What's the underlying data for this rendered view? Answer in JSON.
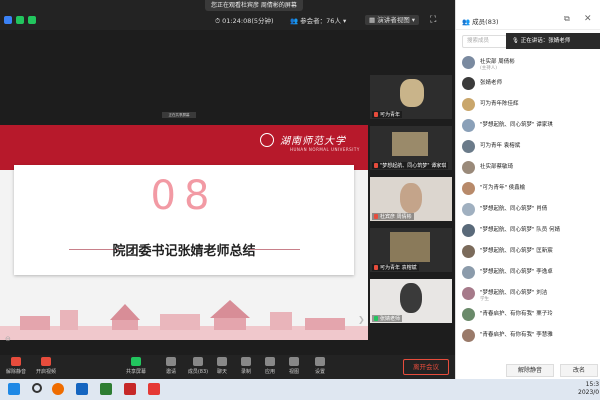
{
  "window": {
    "notice": "您正在观看杜宾彦 周倩彬的屏幕",
    "time": "01:24:08(5分钟)",
    "participants": "参会者：76人",
    "view_mode": "演讲者视图"
  },
  "slide": {
    "caption": "正在共享屏幕",
    "university_cn": "湖南师范大学",
    "university_en": "HUNAN NORMAL UNIVERSITY",
    "number": "08",
    "title": "院团委书记张婧老师总结"
  },
  "videos": [
    {
      "label": "可为青年"
    },
    {
      "label": "\"梦想起航、同心筑梦\" 谭家琪"
    },
    {
      "label": "杜宾彦 周倩彬"
    },
    {
      "label": "可为青年 袁榕斌"
    },
    {
      "label": "张婧老师"
    }
  ],
  "toolbar": {
    "buttons": [
      "解除静音",
      "开启视频",
      "共享屏幕",
      "邀请",
      "成员(83)",
      "聊天",
      "录制",
      "应用",
      "视图",
      "设置"
    ],
    "end_meeting": "离开会议"
  },
  "panel": {
    "title": "成员(83)",
    "search_placeholder": "搜索成员",
    "speaking": "正在讲话：张婧老师",
    "members": [
      {
        "name": "社实部 周倩彬",
        "sub": "(主持人)",
        "color": "#7a8aa0"
      },
      {
        "name": "张婧老师",
        "sub": "",
        "color": "#3b3b3b"
      },
      {
        "name": "可为青年陈佳辉",
        "sub": "",
        "color": "#c9a66b"
      },
      {
        "name": "\"梦想起航、同心筑梦\" 谭家琪",
        "sub": "",
        "color": "#8aa0b8"
      },
      {
        "name": "可为青年 袁榕斌",
        "sub": "",
        "color": "#6b7b8a"
      },
      {
        "name": "社实部蔡敏琦",
        "sub": "",
        "color": "#9a8a7a"
      },
      {
        "name": "\"可为青年\" 侯鑫榆",
        "sub": "",
        "color": "#b88a6a"
      },
      {
        "name": "\"梦想起航、同心筑梦\" 肖倩",
        "sub": "",
        "color": "#a0b0c0"
      },
      {
        "name": "\"梦想起航、同心筑梦\" 队员 何婧",
        "sub": "",
        "color": "#5a6a7a"
      },
      {
        "name": "\"梦想起航、同心筑梦\" 匡新宸",
        "sub": "",
        "color": "#7b6b5b"
      },
      {
        "name": "\"梦想起航、同心筑梦\" 李逸卓",
        "sub": "",
        "color": "#8b9bab"
      },
      {
        "name": "\"梦想起航、同心筑梦\" 刘洁",
        "sub": "学生",
        "color": "#a67a8a"
      },
      {
        "name": "\"青春启护、有你有我\" 栗子玲",
        "sub": "",
        "color": "#6a8a6a"
      },
      {
        "name": "\"青春启护、有你有我\" 李慧雅",
        "sub": "",
        "color": "#9a7a6a"
      }
    ],
    "mute_all": "解除静音",
    "rename": "改名"
  },
  "taskbar": {
    "time": "15:3",
    "date": "2023/0"
  },
  "colors": {
    "brand_red": "#b7192b",
    "number_pink": "#f29aa4",
    "end_red": "#e74c3c"
  }
}
